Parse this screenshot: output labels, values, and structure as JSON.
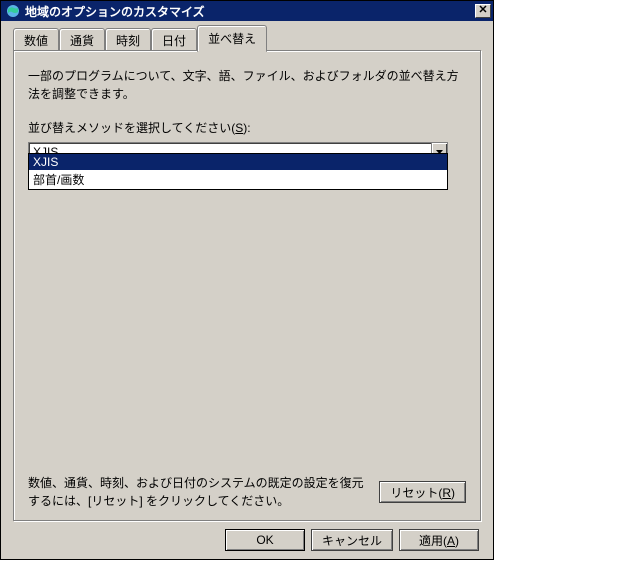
{
  "window": {
    "title": "地域のオプションのカスタマイズ"
  },
  "tabs": {
    "t0": "数値",
    "t1": "通貨",
    "t2": "時刻",
    "t3": "日付",
    "t4": "並べ替え"
  },
  "sort_tab": {
    "description": "一部のプログラムについて、文字、語、ファイル、およびフォルダの並べ替え方法を調整できます。",
    "label_pre": "並び替えメソッドを選択してください(",
    "label_key": "S",
    "label_post": "):",
    "combo_value": "XJIS",
    "options": {
      "o0": "XJIS",
      "o1": "部首/画数"
    }
  },
  "reset": {
    "text": "数値、通貨、時刻、および日付のシステムの既定の設定を復元するには、[リセット] をクリックしてください。",
    "button_pre": "リセット(",
    "button_key": "R",
    "button_post": ")"
  },
  "buttons": {
    "ok": "OK",
    "cancel": "キャンセル",
    "apply_pre": "適用(",
    "apply_key": "A",
    "apply_post": ")"
  }
}
